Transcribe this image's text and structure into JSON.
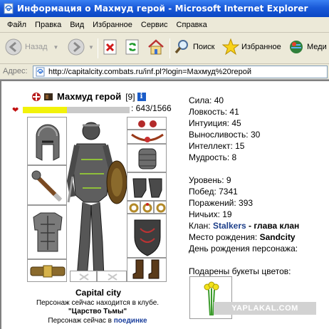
{
  "window": {
    "title": "Информация о Махмуд герой - Microsoft Internet Explorer",
    "icon": "ie-page-icon"
  },
  "menu": [
    "Файл",
    "Правка",
    "Вид",
    "Избранное",
    "Сервис",
    "Справка"
  ],
  "toolbar": {
    "back_label": "Назад",
    "search_label": "Поиск",
    "favorites_label": "Избранное",
    "media_label": "Меди"
  },
  "address": {
    "label": "Адрес:",
    "url": "http://capitalcity.combats.ru/inf.pl?login=Махмуд%20герой"
  },
  "character": {
    "name": "Махмуд герой",
    "level": "[9]",
    "info_badge": "i",
    "hp_text": ": 643/1566",
    "hp_fraction": 0.41,
    "city": "Capital city",
    "club_line": "Персонаж сейчас находится в клубе.",
    "club_name": "\"Царство Тьмы\"",
    "location_prefix": "Персонаж сейчас в ",
    "location_link": "поединке"
  },
  "stats": {
    "strength": "Сила: 40",
    "agility": "Ловкость: 41",
    "intuition": "Интуиция: 45",
    "endurance": "Выносливость: 30",
    "intellect": "Интеллект: 15",
    "wisdom": "Мудрость: 8"
  },
  "info": {
    "level": "Уровень: 9",
    "wins": "Побед: 7341",
    "losses": "Поражений: 393",
    "draws": "Ничьих: 19",
    "clan_prefix": "Клан: ",
    "clan_name": "Stalkers",
    "clan_suffix": " - глава клан",
    "birthplace_prefix": "Место рождения: ",
    "birthplace": "Sandcity",
    "birthday": "День рождения персонажа:",
    "gifts": "Подарены букеты цветов:"
  },
  "watermark": "YAPLAKAL.COM"
}
